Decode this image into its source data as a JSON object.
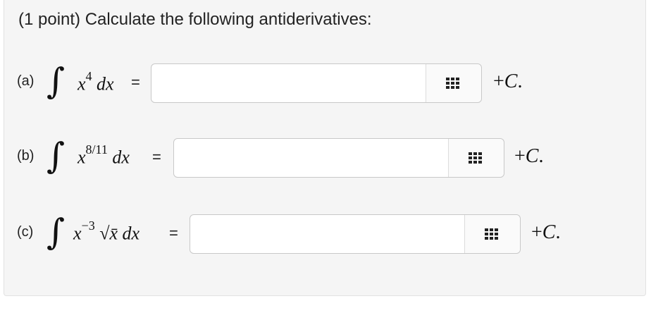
{
  "heading": "(1 point) Calculate the following antiderivatives:",
  "problems": [
    {
      "label": "(a)",
      "integrand_base": "x",
      "exponent": "4",
      "extra": "",
      "dx": "dx",
      "equals": "=",
      "answer_value": "",
      "plus_c": "+C",
      "period": "."
    },
    {
      "label": "(b)",
      "integrand_base": "x",
      "exponent": "8/11",
      "extra": "",
      "dx": "dx",
      "equals": "=",
      "answer_value": "",
      "plus_c": "+C",
      "period": "."
    },
    {
      "label": "(c)",
      "integrand_base": "x",
      "exponent": "−3",
      "extra": "√x̄",
      "dx": "dx",
      "equals": "=",
      "answer_value": "",
      "plus_c": "+C",
      "period": "."
    }
  ],
  "integral_symbol": "∫",
  "palette_icon": "grid-icon"
}
